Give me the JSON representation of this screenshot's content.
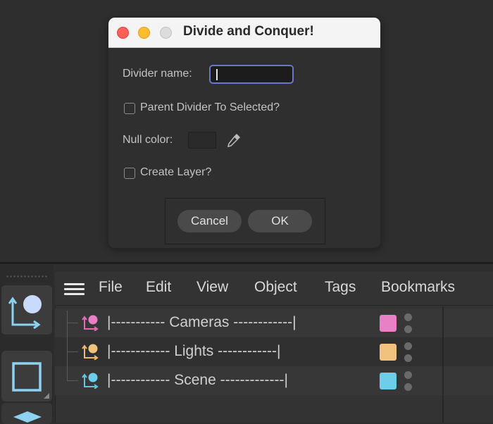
{
  "dialog": {
    "title": "Divide and Conquer!",
    "divider_name_label": "Divider name:",
    "divider_name_value": "",
    "parent_divider_label": "Parent Divider To Selected?",
    "parent_divider_checked": false,
    "null_color_label": "Null color:",
    "create_layer_label": "Create Layer?",
    "create_layer_checked": false,
    "cancel_label": "Cancel",
    "ok_label": "OK"
  },
  "menubar": {
    "items": [
      "File",
      "Edit",
      "View",
      "Object",
      "Tags",
      "Bookmarks"
    ]
  },
  "objects": [
    {
      "name": "|----------- Cameras ------------|",
      "color": "#e97fc4",
      "icon_color": "#e06cb8"
    },
    {
      "name": "|------------ Lights ------------|",
      "color": "#f0c27d",
      "icon_color": "#f0b86a"
    },
    {
      "name": "|------------ Scene -------------|",
      "color": "#6ecde8",
      "icon_color": "#62c3e3"
    }
  ],
  "toolbar": {
    "tools": [
      "null-object-tool",
      "cube-tool",
      "layers-tool"
    ]
  },
  "colors": {
    "accent_focus": "#6e76c8",
    "tool_icon_light": "#c9dafc",
    "tool_icon_stroke": "#8ed1f0"
  }
}
